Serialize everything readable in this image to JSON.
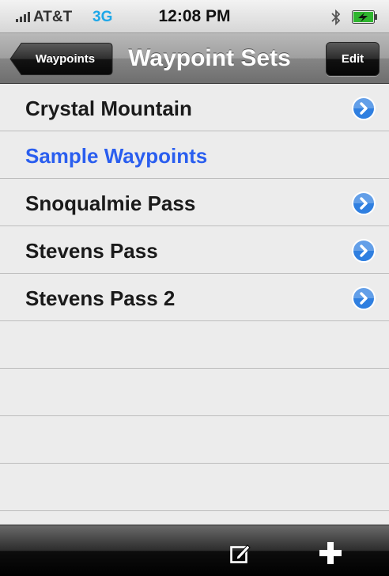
{
  "status_bar": {
    "carrier": "AT&T",
    "network": "3G",
    "time": "12:08 PM",
    "icons": [
      "signal-icon",
      "bluetooth-icon",
      "battery-charging-icon"
    ]
  },
  "nav_bar": {
    "back_label": "Waypoints",
    "title": "Waypoint Sets",
    "edit_label": "Edit"
  },
  "list": {
    "items": [
      {
        "label": "Crystal Mountain",
        "selected": false,
        "disclosure": true
      },
      {
        "label": "Sample Waypoints",
        "selected": true,
        "disclosure": false
      },
      {
        "label": "Snoqualmie Pass",
        "selected": false,
        "disclosure": true
      },
      {
        "label": "Stevens Pass",
        "selected": false,
        "disclosure": true
      },
      {
        "label": "Stevens Pass 2",
        "selected": false,
        "disclosure": true
      }
    ]
  },
  "toolbar": {
    "icons": [
      "compose-icon",
      "add-icon"
    ]
  },
  "colors": {
    "selected_text": "#2a5eef",
    "network_text": "#1ea7e8",
    "disclosure_blue": "#2f7fe0"
  }
}
